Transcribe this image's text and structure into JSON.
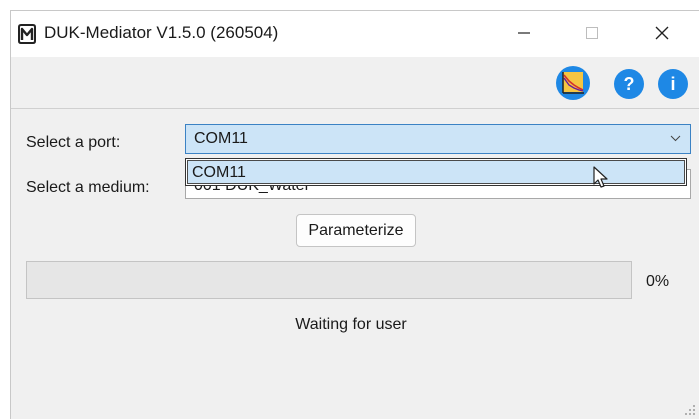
{
  "window": {
    "title": "DUK-Mediator V1.5.0 (260504)",
    "app_icon": "m-logo-icon",
    "controls": [
      "minimize-icon",
      "maximize-icon",
      "close-icon"
    ]
  },
  "toolbar": {
    "buttons": [
      "chart-icon",
      "help-icon",
      "info-icon"
    ],
    "help_glyph": "?",
    "info_glyph": "i",
    "accent": "#1e88e5"
  },
  "form": {
    "port_label": "Select a port:",
    "port_value": "COM11",
    "port_options": [
      "COM11"
    ],
    "medium_label": "Select a medium:",
    "medium_value": "001 DUK_Water"
  },
  "actions": {
    "parameterize_label": "Parameterize"
  },
  "progress": {
    "value": 0,
    "percent_text": "0%",
    "fill_color": "#06b025"
  },
  "status": {
    "text": "Waiting for user"
  }
}
